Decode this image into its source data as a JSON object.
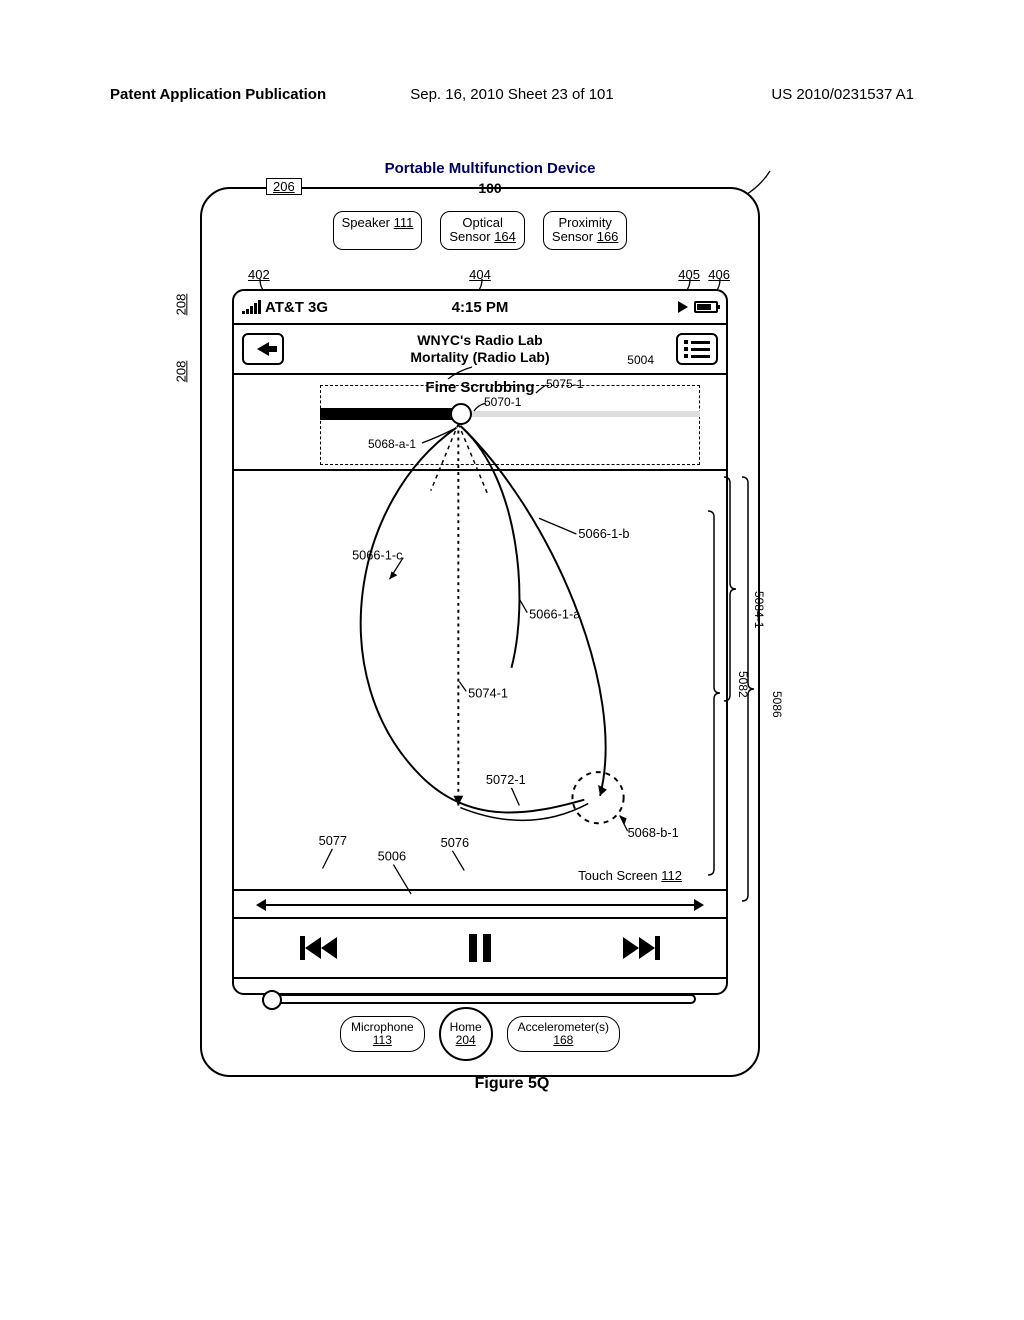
{
  "header": {
    "left": "Patent Application Publication",
    "mid": "Sep. 16, 2010  Sheet 23 of 101",
    "right": "US 2010/0231537 A1"
  },
  "figure": {
    "title": "Portable Multifunction Device",
    "device_ref": "100",
    "caption": "Figure 5Q"
  },
  "refs": {
    "r206": "206",
    "r208": "208",
    "r402": "402",
    "r404": "404",
    "r405": "405",
    "r406": "406",
    "r5004": "5004",
    "r5075_1": "5075-1",
    "r5070_1": "5070-1",
    "r5068_a_1": "5068-a-1",
    "r5066_1_a": "5066-1-a",
    "r5066_1_b": "5066-1-b",
    "r5066_1_c": "5066-1-c",
    "r5074_1": "5074-1",
    "r5072_1": "5072-1",
    "r5068_b_1": "5068-b-1",
    "r5077": "5077",
    "r5076": "5076",
    "r5006": "5006",
    "r5082": "5082",
    "r5084_1": "5084-1",
    "r5086": "5086"
  },
  "sensors": {
    "speaker": "Speaker ",
    "speaker_num": "111",
    "optical_l1": "Optical",
    "optical_l2": "Sensor ",
    "optical_num": "164",
    "prox_l1": "Proximity",
    "prox_l2": "Sensor ",
    "prox_num": "166"
  },
  "statusbar": {
    "carrier": "AT&T 3G",
    "time": "4:15 PM"
  },
  "nav": {
    "line1": "WNYC's Radio Lab",
    "line2": "Mortality (Radio Lab)"
  },
  "scrub": {
    "label": "Fine Scrubbing"
  },
  "touchscreen": {
    "label": "Touch Screen ",
    "num": "112"
  },
  "bottom": {
    "mic": "Microphone",
    "mic_num": "113",
    "home": "Home",
    "home_num": "204",
    "accel": "Accelerometer(s)",
    "accel_num": "168"
  }
}
